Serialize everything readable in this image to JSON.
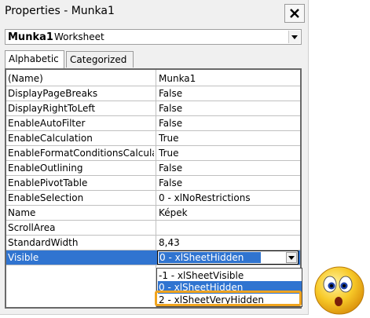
{
  "window": {
    "title": "Properties - Munka1",
    "close_symbol": "✕"
  },
  "object_selector": {
    "name": "Munka1",
    "type": "Worksheet"
  },
  "tabs": [
    {
      "label": "Alphabetic",
      "active": true
    },
    {
      "label": "Categorized",
      "active": false
    }
  ],
  "properties": [
    {
      "name": "(Name)",
      "value": "Munka1"
    },
    {
      "name": "DisplayPageBreaks",
      "value": "False"
    },
    {
      "name": "DisplayRightToLeft",
      "value": "False"
    },
    {
      "name": "EnableAutoFilter",
      "value": "False"
    },
    {
      "name": "EnableCalculation",
      "value": "True"
    },
    {
      "name": "EnableFormatConditionsCalculation",
      "value": "True"
    },
    {
      "name": "EnableOutlining",
      "value": "False"
    },
    {
      "name": "EnablePivotTable",
      "value": "False"
    },
    {
      "name": "EnableSelection",
      "value": "0 - xlNoRestrictions"
    },
    {
      "name": "Name",
      "value": "Képek"
    },
    {
      "name": "ScrollArea",
      "value": ""
    },
    {
      "name": "StandardWidth",
      "value": "8,43"
    },
    {
      "name": "Visible",
      "value": "0 - xlSheetHidden"
    }
  ],
  "visible_dropdown": {
    "options": [
      "-1 - xlSheetVisible",
      "0 - xlSheetHidden",
      "2 - xlSheetVeryHidden"
    ],
    "highlighted": "0 - xlSheetHidden",
    "emphasized": "2 - xlSheetVeryHidden"
  },
  "colors": {
    "selection": "#3074d0",
    "highlight_box": "#f0a41e",
    "smiley": "#f7c928"
  },
  "icons": {
    "close": "close-icon",
    "dropdown": "chevron-down-icon",
    "emoji": "surprised-face-icon"
  }
}
